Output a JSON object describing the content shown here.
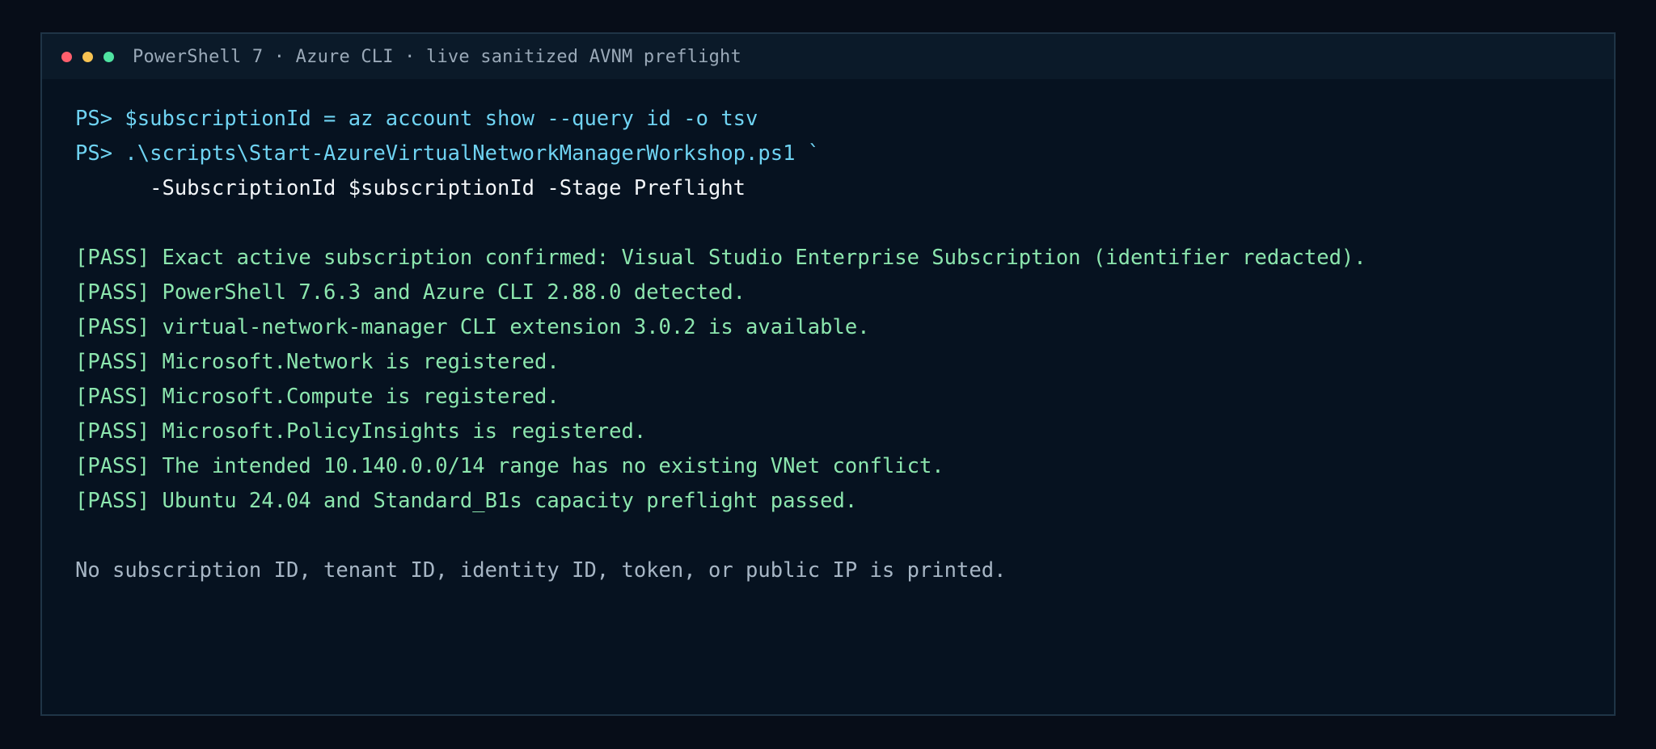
{
  "window": {
    "title": "PowerShell 7 · Azure CLI · live sanitized AVNM preflight",
    "controls": [
      {
        "name": "close",
        "color": "#ff5f6d"
      },
      {
        "name": "minimize",
        "color": "#f8c352"
      },
      {
        "name": "maximize",
        "color": "#4fe3a1"
      }
    ]
  },
  "terminal": {
    "commands": [
      "PS> $subscriptionId = az account show --query id -o tsv",
      "PS> .\\scripts\\Start-AzureVirtualNetworkManagerWorkshop.ps1 `"
    ],
    "continuation": "      -SubscriptionId $subscriptionId -Stage Preflight",
    "results": [
      "[PASS] Exact active subscription confirmed: Visual Studio Enterprise Subscription (identifier redacted).",
      "[PASS] PowerShell 7.6.3 and Azure CLI 2.88.0 detected.",
      "[PASS] virtual-network-manager CLI extension 3.0.2 is available.",
      "[PASS] Microsoft.Network is registered.",
      "[PASS] Microsoft.Compute is registered.",
      "[PASS] Microsoft.PolicyInsights is registered.",
      "[PASS] The intended 10.140.0.0/14 range has no existing VNet conflict.",
      "[PASS] Ubuntu 24.04 and Standard_B1s capacity preflight passed."
    ],
    "note": "No subscription ID, tenant ID, identity ID, token, or public IP is printed."
  },
  "colors": {
    "page_background": "#070d18",
    "window_background": "#061220",
    "titlebar_background": "#0b1a29",
    "border": "#1f3446",
    "prompt": "#6fd3f2",
    "continuation": "#f2f5f8",
    "pass": "#8ce6ae",
    "note": "#a7b6c5",
    "title_text": "#9aa9b8"
  }
}
